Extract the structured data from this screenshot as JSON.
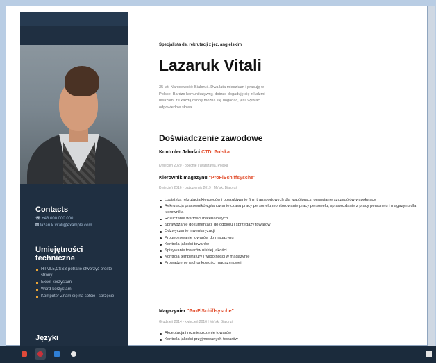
{
  "sidebar": {
    "contacts_title": "Contacts",
    "contact_phone": "+48 000 000 000",
    "contact_email": "lazaruk.vitali@example.com",
    "skills_title_line1": "Umiejętności",
    "skills_title_line2": "techniczne",
    "skills": [
      "HTML5,CSS3-potrafię stworzyć proste strony",
      "Excel-korzystam",
      "Word-korzystam",
      "Komputer-Znam się na sofcie i sprzęcie"
    ],
    "languages_title": "Języki"
  },
  "main": {
    "subtitle": "Specjalista ds. rekrutacji z jęz. angielskim",
    "name": "Lazaruk Vitali",
    "intro": "35 lat, Narodowość: Białoruś. Dwa lata mieszkam i pracuję w Polsce. Bardzo komunikatywny, dobrze dogaduję się z ludźmi uważam, że każdą osobę można się dogadać, jeśli wybrać odpowiednie słowa.",
    "experience_title": "Doświadczenie zawodowe",
    "jobs": [
      {
        "role": "Kontroler Jakości",
        "company": "CTDI Polska",
        "meta": "Kwiecień 2020 - obecnie | Warszawa, Polska"
      },
      {
        "role": "Kierownik magazynu",
        "company": "\"ProFiSchiffsysche\"",
        "meta": "Kwiecień 2016 - październik 2019 | Mińsk, Białoruś",
        "duties": [
          "Logistyka rekrutacja kierowców i poszukiwanie firm transportowych dla współpracy, omawianie szczegółów współpracy",
          "Rekrutacja pracowników,planowanie czasu pracy personelu,monitorowanie pracy personelu, sprawozdanie z pracy personelu i magazynu dla kierownika",
          "Rozliczanie wartości materiałowych",
          "Sprawdzanie dokumentacji do odbioru i sprzedaży towarów",
          "Odzwyczanie inwentaryzacji",
          "Prognozowanie towarów do magazynu",
          "Kontrola jakości towarów",
          "Spisywanie towarów niskiej jakości",
          "Kontrola temperatury i wilgotności w magazynie",
          "Prowadzenie rachunkowości magazynowej"
        ]
      },
      {
        "role": "Magazynier",
        "company": "\"ProFiSchiffsysche\"",
        "meta": "Grudzień 2014 - kwiecień 2016 | Mińsk, Białoruś",
        "duties": [
          "Akceptacja i rozmieszczenie towarów",
          "Kontrola jakości przyjmowanych towarów"
        ]
      }
    ]
  },
  "taskbar": {
    "colors": [
      "#e04a3a",
      "#c8313a",
      "#2f7fd6",
      "#e8e8e8"
    ]
  }
}
